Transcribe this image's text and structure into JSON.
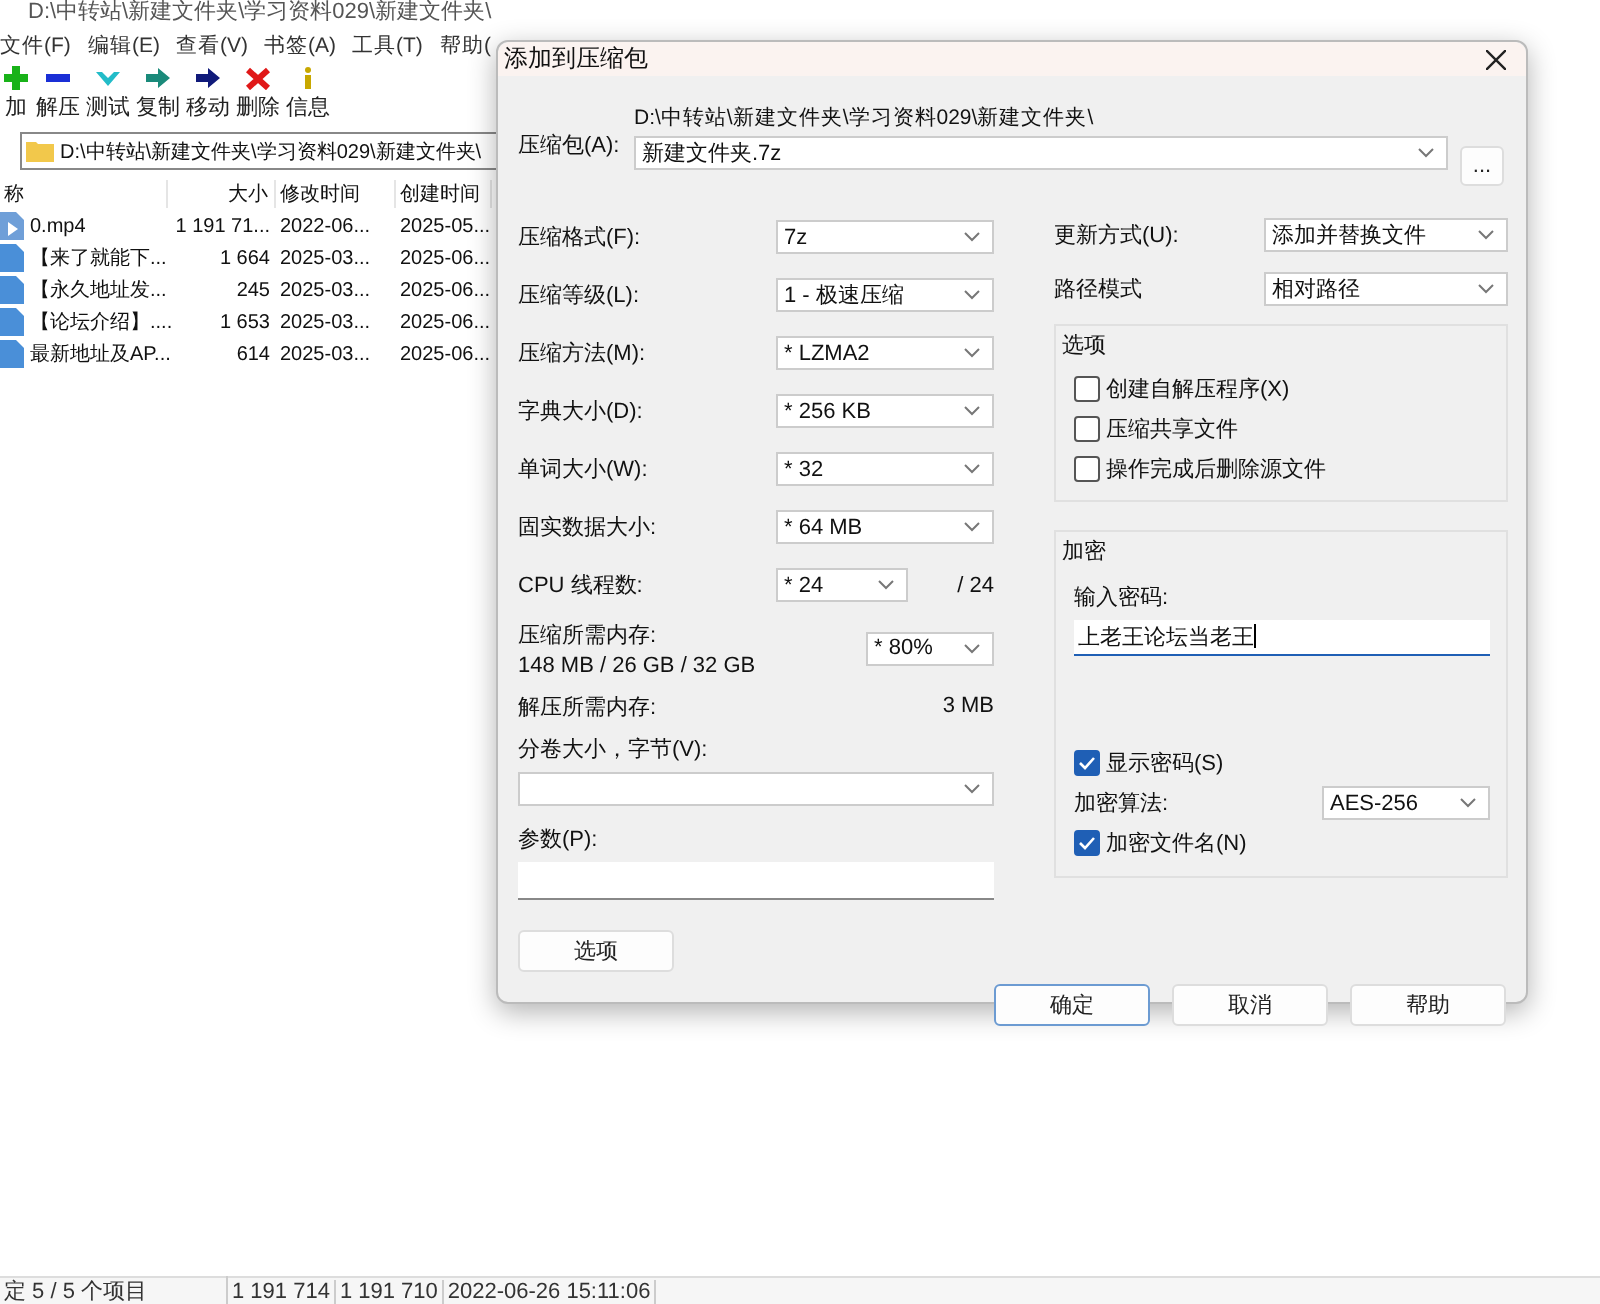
{
  "app": {
    "title": "D:\\中转站\\新建文件夹\\学习资料029\\新建文件夹\\",
    "menu": [
      "文件(F)",
      "编辑(E)",
      "查看(V)",
      "书签(A)",
      "工具(T)",
      "帮助("
    ],
    "toolbar": [
      {
        "label": "加",
        "kind": "add"
      },
      {
        "label": "解压",
        "kind": "extract"
      },
      {
        "label": "测试",
        "kind": "test"
      },
      {
        "label": "复制",
        "kind": "copy"
      },
      {
        "label": "移动",
        "kind": "move"
      },
      {
        "label": "删除",
        "kind": "delete"
      },
      {
        "label": "信息",
        "kind": "info"
      }
    ],
    "address": "D:\\中转站\\新建文件夹\\学习资料029\\新建文件夹\\",
    "columns": [
      "称",
      "大小",
      "修改时间",
      "创建时间"
    ],
    "rows": [
      {
        "kind": "video",
        "name": "0.mp4",
        "size": "1 191 71...",
        "modified": "2022-06...",
        "created": "2025-05..."
      },
      {
        "kind": "doc",
        "name": "【来了就能下...",
        "size": "1 664",
        "modified": "2025-03...",
        "created": "2025-06..."
      },
      {
        "kind": "doc",
        "name": "【永久地址发...",
        "size": "245",
        "modified": "2025-03...",
        "created": "2025-06..."
      },
      {
        "kind": "doc",
        "name": "【论坛介绍】....",
        "size": "1 653",
        "modified": "2025-03...",
        "created": "2025-06..."
      },
      {
        "kind": "doc",
        "name": "最新地址及AP...",
        "size": "614",
        "modified": "2025-03...",
        "created": "2025-06..."
      }
    ],
    "status_bar": [
      "定 5 / 5 个项目",
      "1 191 714",
      "1 191 710",
      "2022-06-26 15:11:06"
    ]
  },
  "dialog": {
    "title": "添加到压缩包",
    "archive_label": "压缩包(A):",
    "archive_path": "D:\\中转站\\新建文件夹\\学习资料029\\新建文件夹\\",
    "archive_name": "新建文件夹.7z",
    "browse": "...",
    "left_rows": [
      {
        "kind": "select",
        "label": "压缩格式(F):",
        "value": "7z"
      },
      {
        "kind": "select",
        "label": "压缩等级(L):",
        "value": "1 - 极速压缩"
      },
      {
        "kind": "select",
        "label": "压缩方法(M):",
        "value": "* LZMA2"
      },
      {
        "kind": "select",
        "label": "字典大小(D):",
        "value": "* 256 KB"
      },
      {
        "kind": "select",
        "label": "单词大小(W):",
        "value": "* 32"
      },
      {
        "kind": "select",
        "label": "固实数据大小:",
        "value": "* 64 MB"
      },
      {
        "kind": "select_suffix",
        "label": "CPU 线程数:",
        "value": "* 24",
        "suffix": "/ 24"
      },
      {
        "kind": "memory",
        "label": "压缩所需内存:",
        "detail": "148 MB / 26 GB / 32 GB",
        "value": "* 80%"
      },
      {
        "kind": "text",
        "label": "解压所需内存:",
        "value": "3 MB"
      }
    ],
    "volume_label": "分卷大小，字节(V):",
    "params_label": "参数(P):",
    "update_label": "更新方式(U):",
    "update_value": "添加并替换文件",
    "path_label": "路径模式",
    "path_value": "相对路径",
    "options_title": "选项",
    "options": [
      {
        "label": "创建自解压程序(X)",
        "checked": false
      },
      {
        "label": "压缩共享文件",
        "checked": false
      },
      {
        "label": "操作完成后删除源文件",
        "checked": false
      }
    ],
    "encryption_title": "加密",
    "password_label": "输入密码:",
    "password": "上老王论坛当老王",
    "show_password": {
      "label": "显示密码(S)",
      "checked": true
    },
    "method_label": "加密算法:",
    "method_value": "AES-256",
    "encrypt_names": {
      "label": "加密文件名(N)",
      "checked": true
    },
    "options_button": "选项",
    "buttons": [
      {
        "label": "确定",
        "selected": true
      },
      {
        "label": "取消",
        "selected": false
      },
      {
        "label": "帮助",
        "selected": false
      }
    ]
  }
}
